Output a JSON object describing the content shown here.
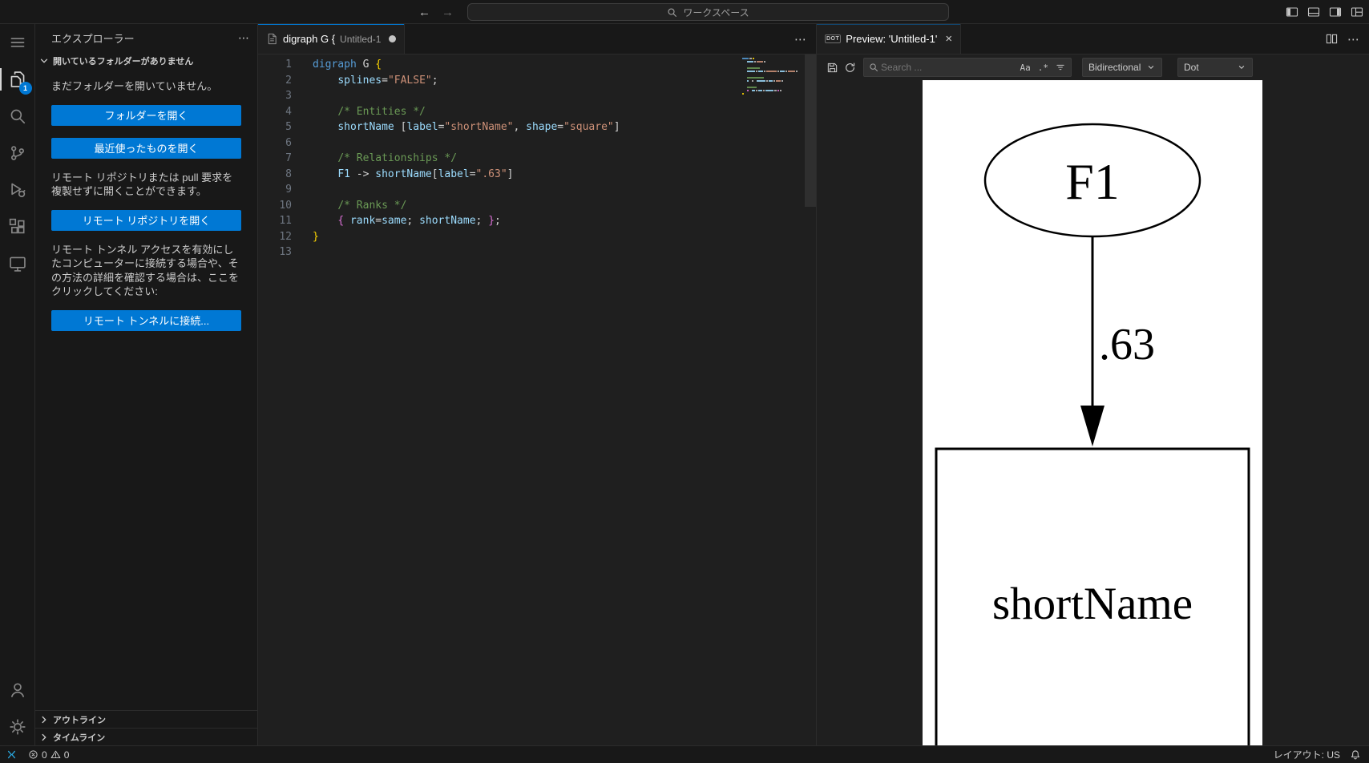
{
  "titleBar": {
    "commandCenter": "ワークスペース"
  },
  "activityBar": {
    "badge": "1"
  },
  "sidebar": {
    "title": "エクスプローラー",
    "sectionHeader": "開いているフォルダーがありません",
    "noFolderText": "まだフォルダーを開いていません。",
    "openFolderButton": "フォルダーを開く",
    "openRecentButton": "最近使ったものを開く",
    "remoteRepoText": "リモート リポジトリまたは pull 要求を複製せずに開くことができます。",
    "openRemoteRepoButton": "リモート リポジトリを開く",
    "tunnelText": "リモート トンネル アクセスを有効にしたコンピューターに接続する場合や、その方法の詳細を確認する場合は、ここをクリックしてください:",
    "connectTunnelButton": "リモート トンネルに接続...",
    "outlineSection": "アウトライン",
    "timelineSection": "タイムライン"
  },
  "editor": {
    "tabLabel": "digraph G {",
    "tabDescription": "Untitled-1",
    "codeLines": [
      {
        "num": "1",
        "tokens": [
          [
            "digraph",
            "kw"
          ],
          [
            " G ",
            "fg"
          ],
          [
            "{",
            "b1"
          ]
        ]
      },
      {
        "num": "2",
        "tokens": [
          [
            "    ",
            "fg"
          ],
          [
            "splines",
            "var"
          ],
          [
            "=",
            "fg"
          ],
          [
            "\"FALSE\"",
            "str"
          ],
          [
            ";",
            "fg"
          ]
        ]
      },
      {
        "num": "3",
        "tokens": []
      },
      {
        "num": "4",
        "tokens": [
          [
            "    ",
            "fg"
          ],
          [
            "/* Entities */",
            "com"
          ]
        ]
      },
      {
        "num": "5",
        "tokens": [
          [
            "    ",
            "fg"
          ],
          [
            "shortName",
            "var"
          ],
          [
            " [",
            "fg"
          ],
          [
            "label",
            "var"
          ],
          [
            "=",
            "fg"
          ],
          [
            "\"shortName\"",
            "str"
          ],
          [
            ", ",
            "fg"
          ],
          [
            "shape",
            "var"
          ],
          [
            "=",
            "fg"
          ],
          [
            "\"square\"",
            "str"
          ],
          [
            "]",
            "fg"
          ]
        ]
      },
      {
        "num": "6",
        "tokens": []
      },
      {
        "num": "7",
        "tokens": [
          [
            "    ",
            "fg"
          ],
          [
            "/* Relationships */",
            "com"
          ]
        ]
      },
      {
        "num": "8",
        "tokens": [
          [
            "    ",
            "fg"
          ],
          [
            "F1",
            "var"
          ],
          [
            " ",
            "fg"
          ],
          [
            "->",
            "fg"
          ],
          [
            " ",
            "fg"
          ],
          [
            "shortName",
            "var"
          ],
          [
            "[",
            "fg"
          ],
          [
            "label",
            "var"
          ],
          [
            "=",
            "fg"
          ],
          [
            "\".63\"",
            "str"
          ],
          [
            "]",
            "fg"
          ]
        ]
      },
      {
        "num": "9",
        "tokens": []
      },
      {
        "num": "10",
        "tokens": [
          [
            "    ",
            "fg"
          ],
          [
            "/* Ranks */",
            "com"
          ]
        ]
      },
      {
        "num": "11",
        "tokens": [
          [
            "    ",
            "fg"
          ],
          [
            "{",
            "b2"
          ],
          [
            " ",
            "fg"
          ],
          [
            "rank",
            "var"
          ],
          [
            "=",
            "fg"
          ],
          [
            "same",
            "var"
          ],
          [
            "; ",
            "fg"
          ],
          [
            "shortName",
            "var"
          ],
          [
            "; ",
            "fg"
          ],
          [
            "}",
            "b2"
          ],
          [
            ";",
            "fg"
          ]
        ]
      },
      {
        "num": "12",
        "tokens": [
          [
            "}",
            "b1"
          ]
        ]
      },
      {
        "num": "13",
        "tokens": []
      }
    ]
  },
  "preview": {
    "tabIcon": "DOT",
    "tabLabel": "Preview: 'Untitled-1'",
    "searchPlaceholder": "Search ...",
    "matchCase": "Aa",
    "regex": ".*",
    "directionSelect": "Bidirectional",
    "engineSelect": "Dot",
    "graph": {
      "node1Label": "F1",
      "edgeLabel": ".63",
      "node2Label": "shortName"
    }
  },
  "statusBar": {
    "errors": "0",
    "warnings": "0",
    "layout": "レイアウト: US"
  },
  "icons": {
    "back": "←",
    "forward": "→",
    "more": "⋯",
    "close": "×"
  },
  "colors": {
    "accent": "#0078d4",
    "buttonBackground": "#0078d4",
    "badgeBackground": "#0078d4"
  }
}
